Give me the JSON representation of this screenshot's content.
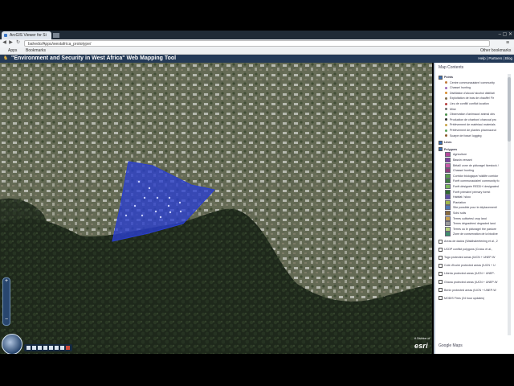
{
  "browser": {
    "tab_title": "ArcGIS Viewer for Si",
    "window_controls": "– ▢ ✕",
    "url": "bahedo/Apps/westafrica_prototype/",
    "bookmarks": [
      "Apps",
      "Bookmarks"
    ],
    "other_bookmarks": "Other bookmarks"
  },
  "app": {
    "title": "\"Environment and Security in West Africa\" Web Mapping Tool",
    "links": "Help | Partners | Blog"
  },
  "map": {
    "logo": "esri",
    "logo_caption": "A Division of",
    "zoom_in": "+",
    "zoom_out": "−"
  },
  "panel": {
    "title": "Map Contents",
    "groups": [
      {
        "label": "Points",
        "checked": true
      },
      {
        "label": "Lines",
        "checked": true
      },
      {
        "label": "Polygons",
        "checked": true
      }
    ],
    "point_items": [
      {
        "label": "Centre communautaire/ community",
        "color": "#c27a3a"
      },
      {
        "label": "Chasse/ hunting",
        "color": "#9b6bb7"
      },
      {
        "label": "Distillation d'alcool/ alcohol distillati",
        "color": "#d98c2e"
      },
      {
        "label": "Exploitation de bois de chauffe/ Fir",
        "color": "#7c6b4e"
      },
      {
        "label": "Lieu de conflit/ conflict location",
        "color": "#b43b3b"
      },
      {
        "label": "Mine",
        "color": "#6d6d6d"
      },
      {
        "label": "Observation d'animaux/ animal obs",
        "color": "#4a8f4a"
      },
      {
        "label": "Production de charbon/ charcoal pro",
        "color": "#333333"
      },
      {
        "label": "Prélèvement de matériau/ materials",
        "color": "#c9a347"
      },
      {
        "label": "Prélèvement de plantes pharmaceut",
        "color": "#5aa15a"
      },
      {
        "label": "Scarpe de fosse/ logging",
        "color": "#8a5a2b"
      }
    ],
    "polygon_items": [
      {
        "label": "Agriculture",
        "color": "#b5479a"
      },
      {
        "label": "Bassin versant",
        "color": "#7a3f9e"
      },
      {
        "label": "Bétail/ zone de pâturage/ livestock /",
        "color": "#c85aa8"
      },
      {
        "label": "Chasse/ hunting",
        "color": "#8e3d7a"
      },
      {
        "label": "Corridor biologique/ wildlife corridor",
        "color": "#5a9e4b"
      },
      {
        "label": "Forêt communautaire/ community fo",
        "color": "#3c7a3c"
      },
      {
        "label": "Forêt désignée REDD+/ designated",
        "color": "#7ab85a"
      },
      {
        "label": "Forêt primaire/ primary forest",
        "color": "#2f6a2f"
      },
      {
        "label": "Habitat / skoo",
        "color": "#5f4fa8"
      },
      {
        "label": "Plantation",
        "color": "#a0b84a"
      },
      {
        "label": "Site possible pour le déplacement/",
        "color": "#4f78b8"
      },
      {
        "label": "Sols/ soils",
        "color": "#8a6b3c"
      },
      {
        "label": "Terres cultivées/ crop land",
        "color": "#c8a050"
      },
      {
        "label": "Terres dégradées/ degraded land",
        "color": "#9a9a9a"
      },
      {
        "label": "Terres où le pâturage/ the pasture",
        "color": "#b8d27a"
      },
      {
        "label": "Zone de conservation de la biodive",
        "color": "#3f8f6f"
      }
    ],
    "other_layers": [
      "Areas de dados (Waldhaleetening et al., 2",
      "UCDP conflict polygons (Croicu et al.,",
      "Togo protected areas (IUCN + UNEP-W",
      "Cote d'Ivoire protected areas (IUCN + U",
      "Liberia protected areas (IUCN + UNEP-",
      "Ghana protected areas (IUCN + UNEP-W",
      "Benin protected areas (IUCN + UNEP-W",
      "MODIS Fires (24 hour updates)"
    ],
    "basemap_label": "Google Maps"
  },
  "colors": {
    "header": "#243a57",
    "polygon_fill": "#2a3fd0",
    "forest": "#1f2a1c"
  }
}
